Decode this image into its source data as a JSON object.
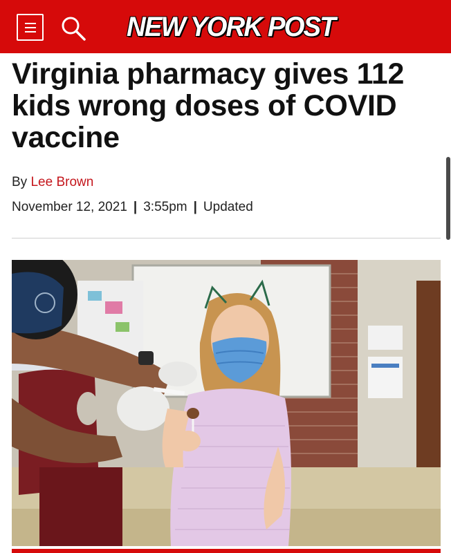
{
  "header": {
    "logo_text": "NEW YORK POST",
    "background_color": "#d60a0a",
    "menu_icon": "hamburger-menu-icon",
    "search_icon": "search-icon"
  },
  "article": {
    "headline": "Virginia pharmacy gives 112 kids wrong doses of COVID vaccine",
    "byline_prefix": "By",
    "author": "Lee Brown",
    "date": "November 12, 2021",
    "separator": "|",
    "time": "3:55pm",
    "updated_label": "Updated",
    "photo_subject": "Child in blue mask receiving vaccine"
  },
  "colors": {
    "brand_red": "#d60a0a",
    "author_link": "#c4161c",
    "text": "#222222"
  }
}
